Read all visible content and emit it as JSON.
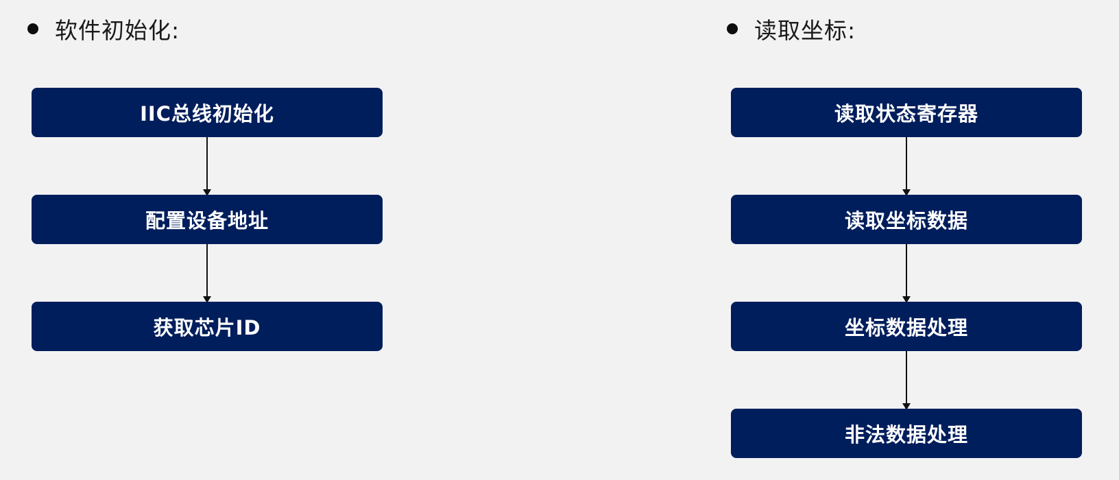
{
  "left": {
    "heading": "软件初始化:",
    "steps": [
      "IIC总线初始化",
      "配置设备地址",
      "获取芯片ID"
    ]
  },
  "right": {
    "heading": "读取坐标:",
    "steps": [
      "读取状态寄存器",
      "读取坐标数据",
      "坐标数据处理",
      "非法数据处理"
    ]
  },
  "colors": {
    "background": "#f2f2f3",
    "box_fill": "#011e5c",
    "box_text": "#ffffff",
    "arrow": "#111111"
  }
}
